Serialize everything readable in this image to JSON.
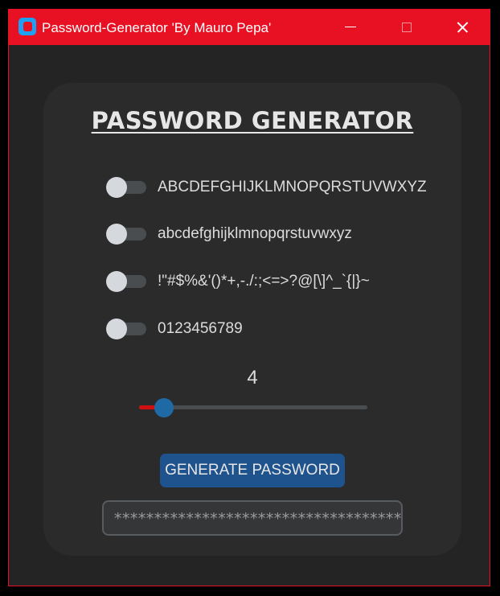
{
  "window": {
    "title": "Password-Generator 'By Mauro Pepa'",
    "accent_color": "#e81123",
    "controls": [
      "minimize-icon",
      "maximize-icon",
      "close-icon"
    ]
  },
  "main": {
    "heading": "PASSWORD GENERATOR",
    "options": [
      {
        "label": "ABCDEFGHIJKLMNOPQRSTUVWXYZ",
        "enabled": false
      },
      {
        "label": "abcdefghijklmnopqrstuvwxyz",
        "enabled": false
      },
      {
        "label": "!\"#$%&'()*+,-./:;<=>?@[\\]^_`{|}~",
        "enabled": false
      },
      {
        "label": "0123456789",
        "enabled": false
      }
    ],
    "length_value": "4",
    "length_fraction": 0.11,
    "generate_label": "GENERATE PASSWORD",
    "password_output": "**************************************",
    "colors": {
      "slider_fill": "#d01010",
      "slider_thumb": "#1f6aa5",
      "button": "#1f538d"
    }
  }
}
